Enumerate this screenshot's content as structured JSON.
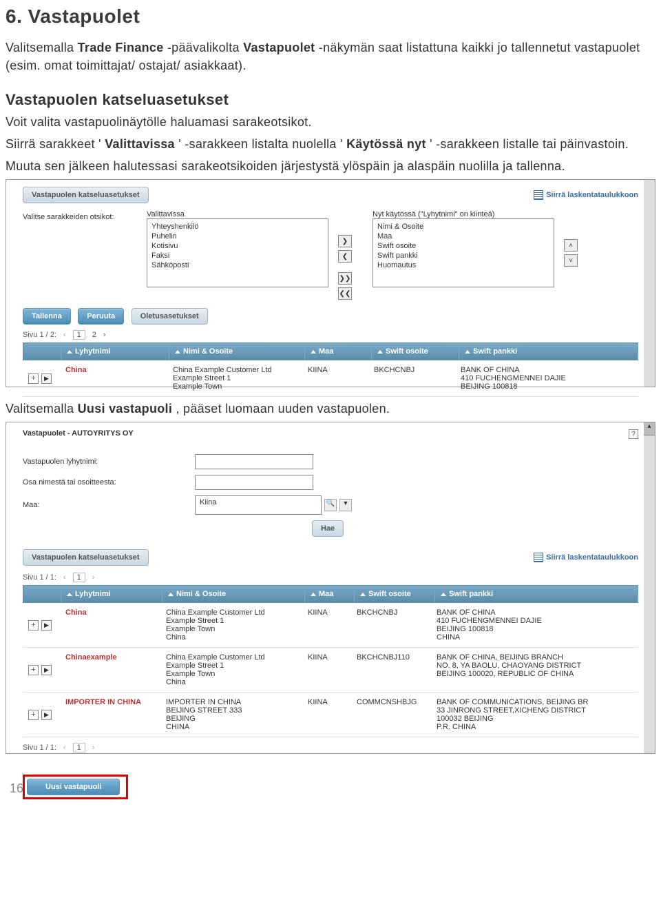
{
  "heading": "6. Vastapuolet",
  "intro": {
    "p1a": "Valitsemalla ",
    "p1b": "Trade Finance",
    "p1c": " -päävalikolta ",
    "p1d": "Vastapuolet",
    "p1e": " -näkymän saat listattuna kaikki jo tallennetut vastapuolet (esim. omat toimittajat/ ostajat/ asiakkaat)."
  },
  "sub": "Vastapuolen katseluasetukset",
  "para": {
    "l1": "Voit valita vastapuolinäytölle haluamasi sarakeotsikot.",
    "l2a": "Siirrä sarakkeet '",
    "l2b": "Valittavissa",
    "l2c": "' -sarakkeen listalta nuolella '",
    "l2d": "Käytössä nyt",
    "l2e": "' -sarakkeen listalle tai päinvastoin.",
    "l3": "Muuta sen jälkeen halutessasi sarakeotsikoiden järjestystä ylöspäin ja alaspäin nuolilla ja tallenna."
  },
  "shot1": {
    "btn_view": "Vastapuolen katseluasetukset",
    "link_export": "Siirrä laskentataulukkoon",
    "label_select": "Valitse sarakkeiden otsikot:",
    "avail_label": "Valittavissa",
    "avail": [
      "Yhteyshenkilö",
      "Puhelin",
      "Kotisivu",
      "Faksi",
      "Sähköposti"
    ],
    "used_label": "Nyt käytössä (\"Lyhytnimi\" on kiinteä)",
    "used": [
      "Nimi & Osoite",
      "Maa",
      "Swift osoite",
      "Swift pankki",
      "Huomautus"
    ],
    "btn_r": "❯",
    "btn_l": "❮",
    "btn_rr": "❯❯",
    "btn_ll": "❮❮",
    "btn_up": "˄",
    "btn_dn": "˅",
    "btn_save": "Tallenna",
    "btn_cancel": "Peruuta",
    "btn_def": "Oletusasetukset",
    "pager": "Sivu 1 / 2:",
    "pages": [
      "1",
      "2"
    ],
    "cols": {
      "c1": "Lyhytnimi",
      "c2": "Nimi & Osoite",
      "c3": "Maa",
      "c4": "Swift osoite",
      "c5": "Swift pankki"
    },
    "row": {
      "short": "China",
      "name": "China Example Customer Ltd\nExample Street 1\nExample Town",
      "maa": "KIINA",
      "swift": "BKCHCNBJ",
      "bank": "BANK OF CHINA\n410 FUCHENGMENNEI DAJIE\nBEIJING 100818"
    }
  },
  "midtext": {
    "a": "Valitsemalla ",
    "b": "Uusi vastapuoli",
    "c": ", pääset luomaan uuden vastapuolen."
  },
  "shot2": {
    "title": "Vastapuolet - AUTOYRITYS OY",
    "f1": "Vastapuolen lyhytnimi:",
    "f2": "Osa nimestä tai osoitteesta:",
    "f3": "Maa:",
    "f3val": "Kiina",
    "btn_search": "Hae",
    "btn_view": "Vastapuolen katseluasetukset",
    "link_export": "Siirrä laskentataulukkoon",
    "pager": "Sivu 1 / 1:",
    "page": "1",
    "cols": {
      "c1": "Lyhytnimi",
      "c2": "Nimi & Osoite",
      "c3": "Maa",
      "c4": "Swift osoite",
      "c5": "Swift pankki"
    },
    "rows": [
      {
        "short": "China",
        "name": "China Example Customer Ltd\nExample Street 1\nExample Town\nChina",
        "maa": "KIINA",
        "swift": "BKCHCNBJ",
        "bank": "BANK OF CHINA\n410 FUCHENGMENNEI DAJIE\nBEIJING 100818\nCHINA"
      },
      {
        "short": "Chinaexample",
        "name": "China Example Customer Ltd\nExample Street 1\nExample Town\nChina",
        "maa": "KIINA",
        "swift": "BKCHCNBJ110",
        "bank": "BANK OF CHINA, BEIJING BRANCH\nNO. 8, YA BAOLU, CHAOYANG DISTRICT\nBEIJING 100020, REPUBLIC OF CHINA"
      },
      {
        "short": "IMPORTER IN CHINA",
        "name": "IMPORTER IN CHINA\nBEIJING STREET 333\nBEIJING\nCHINA",
        "maa": "KIINA",
        "swift": "COMMCNSHBJG",
        "bank": "BANK OF COMMUNICATIONS, BEIJING BR\n33 JINRONG STREET,XICHENG DISTRICT\n100032 BEIJING\nP.R. CHINA"
      }
    ],
    "pager2": "Sivu 1 / 1:",
    "btn_new": "Uusi vastapuoli"
  },
  "pagenum": "16"
}
